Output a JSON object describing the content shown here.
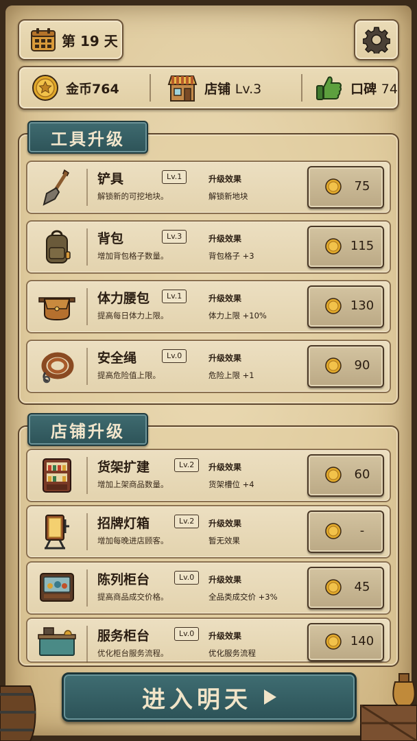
{
  "header": {
    "day_label": "第 19 天"
  },
  "stats": {
    "gold": "金币764",
    "shop_label": "店铺",
    "shop_level": "Lv.3",
    "reputation_label": "口碑",
    "reputation_value": "74"
  },
  "tools": {
    "title": "工具升级",
    "items": [
      {
        "name": "铲具",
        "level": "Lv.1",
        "desc": "解锁新的可挖地块。",
        "effect_title": "升级效果",
        "effect": "解锁新地块",
        "price": "75",
        "icon": "shovel-icon"
      },
      {
        "name": "背包",
        "level": "Lv.3",
        "desc": "增加背包格子数量。",
        "effect_title": "升级效果",
        "effect": "背包格子 +3",
        "price": "115",
        "icon": "backpack-icon"
      },
      {
        "name": "体力腰包",
        "level": "Lv.1",
        "desc": "提高每日体力上限。",
        "effect_title": "升级效果",
        "effect": "体力上限 +10%",
        "price": "130",
        "icon": "waist-pouch-icon"
      },
      {
        "name": "安全绳",
        "level": "Lv.0",
        "desc": "提高危险值上限。",
        "effect_title": "升级效果",
        "effect": "危险上限 +1",
        "price": "90",
        "icon": "rope-icon"
      }
    ]
  },
  "shop": {
    "title": "店铺升级",
    "items": [
      {
        "name": "货架扩建",
        "level": "Lv.2",
        "desc": "增加上架商品数量。",
        "effect_title": "升级效果",
        "effect": "货架槽位 +4",
        "price": "60",
        "icon": "shelf-icon"
      },
      {
        "name": "招牌灯箱",
        "level": "Lv.2",
        "desc": "增加每晚进店顾客。",
        "effect_title": "升级效果",
        "effect": "暂无效果",
        "price": "-",
        "icon": "lightbox-sign-icon"
      },
      {
        "name": "陈列柜台",
        "level": "Lv.0",
        "desc": "提高商品成交价格。",
        "effect_title": "升级效果",
        "effect": "全品类成交价 +3%",
        "price": "45",
        "icon": "display-case-icon"
      },
      {
        "name": "服务柜台",
        "level": "Lv.0",
        "desc": "优化柜台服务流程。",
        "effect_title": "升级效果",
        "effect": "优化服务流程",
        "price": "140",
        "icon": "service-counter-icon"
      }
    ]
  },
  "footer": {
    "next_day_label": "进入明天"
  },
  "colors": {
    "teal_banner": "#2d5358",
    "parchment": "#e0cca0",
    "gold_coin": "#e0a82a"
  }
}
